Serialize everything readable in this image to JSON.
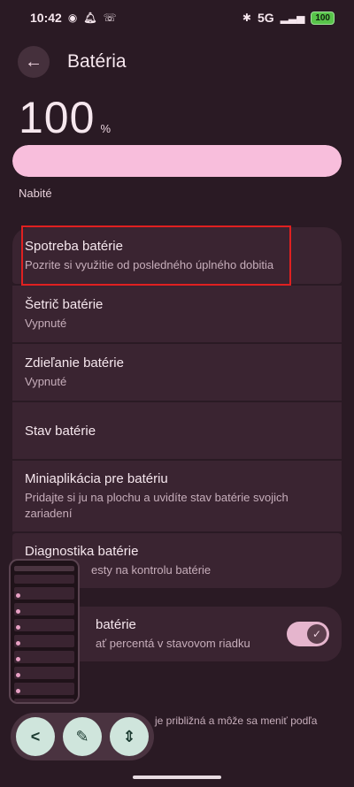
{
  "status_bar": {
    "time": "10:42",
    "network": "5G",
    "battery": "100"
  },
  "header": {
    "title": "Batéria"
  },
  "battery": {
    "level": "100",
    "unit": "%",
    "fill_fraction": 1.0,
    "state": "Nabité"
  },
  "list": [
    {
      "title": "Spotreba batérie",
      "subtitle": "Pozrite si využitie od posledného úplného dobitia"
    },
    {
      "title": "Šetrič batérie",
      "subtitle": "Vypnuté"
    },
    {
      "title": "Zdieľanie batérie",
      "subtitle": "Vypnuté"
    },
    {
      "title": "Stav batérie",
      "subtitle": ""
    },
    {
      "title": "Miniaplikácia pre batériu",
      "subtitle": "Pridajte si ju na plochu a uvidíte stav batérie svojich zariadení"
    },
    {
      "title": "Diagnostika batérie",
      "subtitle": "esty na kontrolu batérie"
    }
  ],
  "toggle_item": {
    "title": "batérie",
    "subtitle": "ať percentá v stavovom riadku",
    "enabled": true
  },
  "footer_note": "je približná a môže sa meniť podľa",
  "colors": {
    "background": "#2a1a24",
    "card": "#3a2431",
    "accent": "#f8bedc",
    "highlight": "#e02020"
  }
}
